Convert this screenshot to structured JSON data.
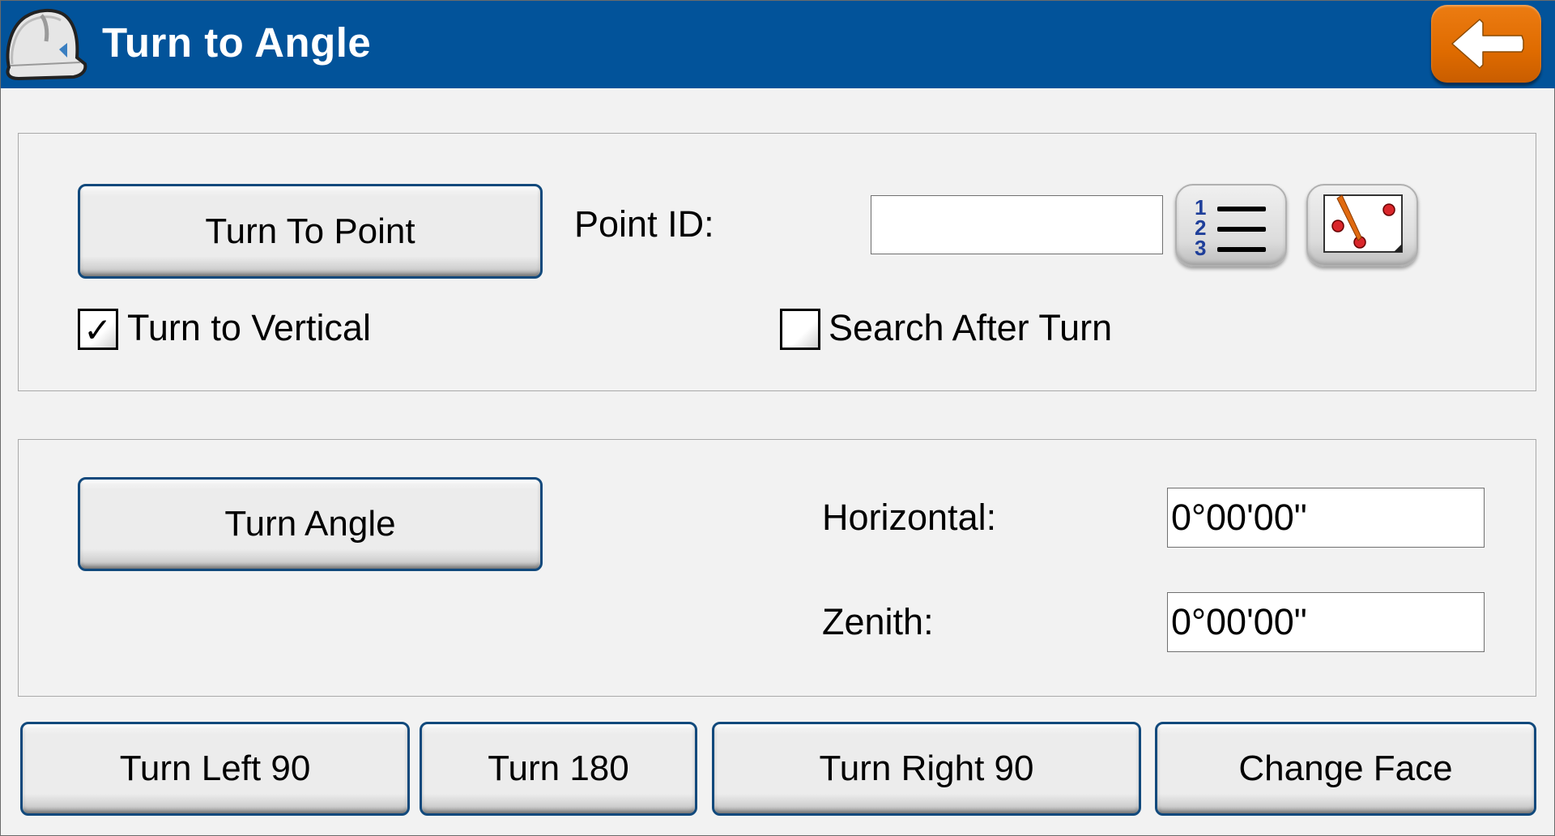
{
  "header": {
    "title": "Turn to Angle",
    "logo_icon": "hard-hat-icon",
    "back_icon": "arrow-left-icon",
    "accent_color": "#02539a",
    "back_color": "#df6b00"
  },
  "turn_to_point": {
    "button_label": "Turn To Point",
    "point_id_label": "Point ID:",
    "point_id_value": "",
    "list_icon": "numbered-list-icon",
    "map_icon": "map-pick-icon",
    "turn_to_vertical": {
      "label": "Turn to Vertical",
      "checked": true,
      "mark": "✓"
    },
    "search_after_turn": {
      "label": "Search After Turn",
      "checked": false
    }
  },
  "turn_angle": {
    "button_label": "Turn Angle",
    "horizontal_label": "Horizontal:",
    "horizontal_value": "0°00'00\"",
    "zenith_label": "Zenith:",
    "zenith_value": "0°00'00\""
  },
  "actions": [
    {
      "label": "Turn Left 90"
    },
    {
      "label": "Turn 180"
    },
    {
      "label": "Turn Right 90"
    },
    {
      "label": "Change Face"
    }
  ]
}
